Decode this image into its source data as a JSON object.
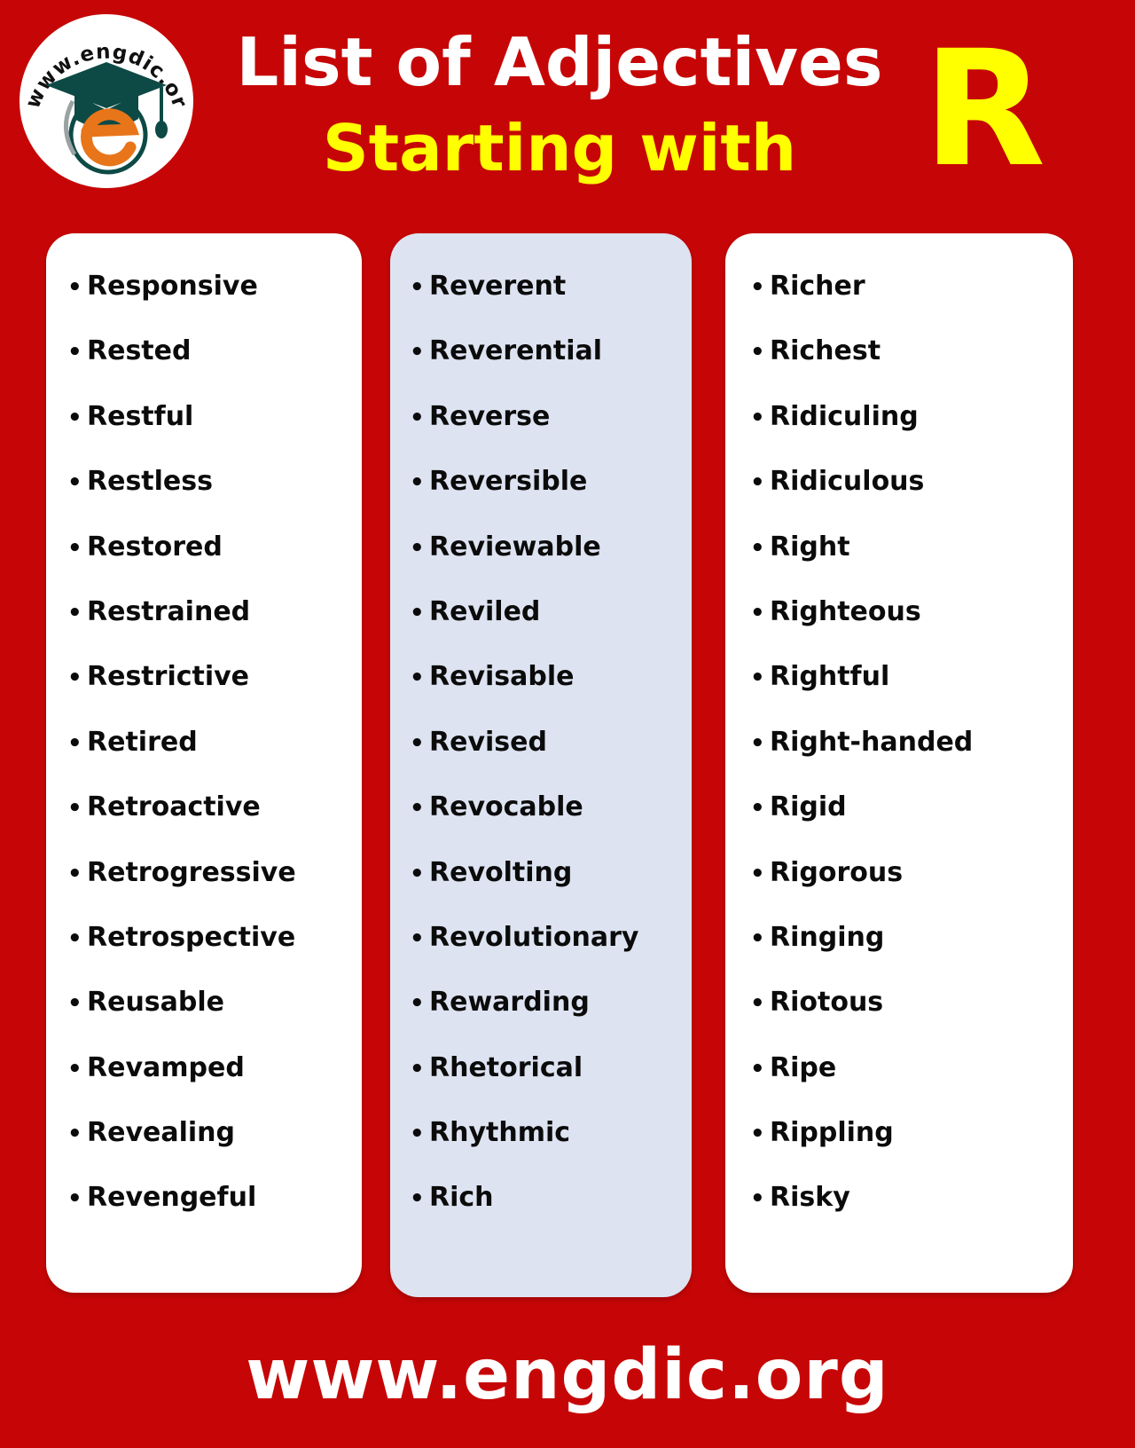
{
  "theme": {
    "background_red": "#c60606",
    "accent_yellow": "#ffff00",
    "card_white": "#ffffff",
    "card_blue": "#dde3f1",
    "text_black": "#0b0b0b"
  },
  "header": {
    "logo_text": "www.engdic.org",
    "logo_letter": "e",
    "title_line1": "List of Adjectives",
    "title_line2": "Starting with",
    "big_letter": "R"
  },
  "columns": [
    {
      "id": "column-1",
      "background": "#ffffff",
      "bullet": "•",
      "words": [
        "Responsive",
        "Rested",
        "Restful",
        "Restless",
        "Restored",
        "Restrained",
        "Restrictive",
        "Retired",
        "Retroactive",
        "Retrogressive",
        "Retrospective",
        "Reusable",
        "Revamped",
        "Revealing",
        "Revengeful"
      ]
    },
    {
      "id": "column-2",
      "background": "#dde3f1",
      "bullet": "•",
      "words": [
        "Reverent",
        "Reverential",
        "Reverse",
        "Reversible",
        "Reviewable",
        "Reviled",
        "Revisable",
        "Revised",
        "Revocable",
        "Revolting",
        "Revolutionary",
        "Rewarding",
        "Rhetorical",
        "Rhythmic",
        "Rich"
      ]
    },
    {
      "id": "column-3",
      "background": "#ffffff",
      "bullet": "•",
      "words": [
        "Richer",
        "Richest",
        "Ridiculing",
        "Ridiculous",
        "Right",
        "Righteous",
        "Rightful",
        "Right-handed",
        "Rigid",
        "Rigorous",
        "Ringing",
        "Riotous",
        "Ripe",
        "Rippling",
        "Risky"
      ]
    }
  ],
  "footer": {
    "website": "www.engdic.org"
  }
}
